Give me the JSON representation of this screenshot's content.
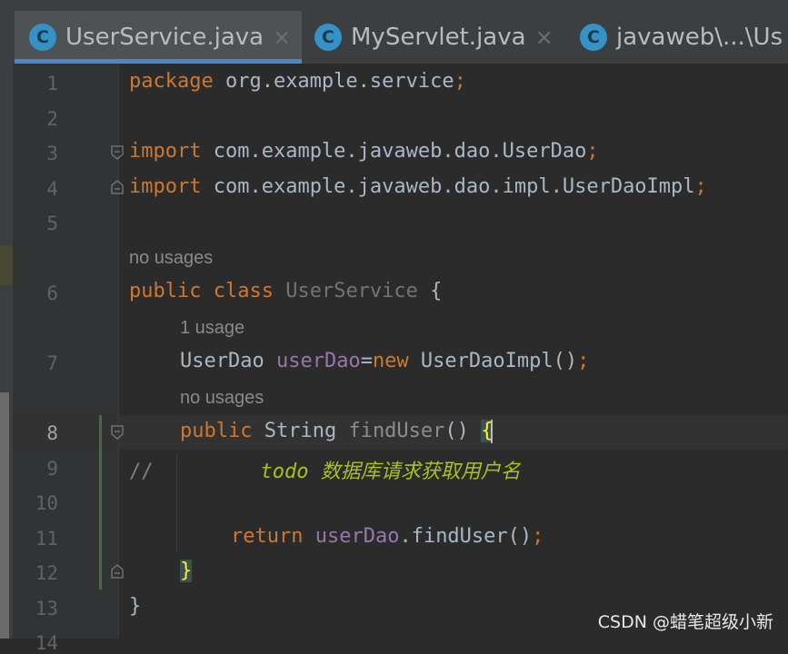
{
  "tabs": [
    {
      "icon": "C",
      "label": "UserService.java",
      "close": "×",
      "active": true
    },
    {
      "icon": "C",
      "label": "MyServlet.java",
      "close": "×",
      "active": false
    },
    {
      "icon": "C",
      "label": "javaweb\\...\\Us",
      "active": false
    }
  ],
  "line_numbers": [
    "1",
    "2",
    "3",
    "4",
    "5",
    "6",
    "7",
    "8",
    "9",
    "10",
    "11",
    "12",
    "13",
    "14"
  ],
  "code": {
    "l1_kw": "package",
    "l1_rest": " org.example.service",
    "l1_semi": ";",
    "l3_kw": "import",
    "l3_rest": " com.example.javaweb.dao.UserDao",
    "l3_semi": ";",
    "l4_kw": "import",
    "l4_rest": " com.example.javaweb.dao.impl.UserDaoImpl",
    "l4_semi": ";",
    "hint_class": "no usages",
    "l6_kw1": "public",
    "l6_kw2": " class",
    "l6_name": " UserService",
    "l6_brace": " {",
    "hint_field": "1 usage",
    "l7_type": "UserDao",
    "l7_field": " userDao",
    "l7_eq": "=",
    "l7_new": "new",
    "l7_ctor": " UserDaoImpl()",
    "l7_semi": ";",
    "hint_method": "no usages",
    "l8_kw": "public",
    "l8_type": " String",
    "l8_name": " findUser",
    "l8_parens": "() ",
    "l8_brace": "{",
    "l9_comment": "//",
    "l9_todo": "todo 数据库请求获取用户名",
    "l11_kw": "return",
    "l11_field": " userDao",
    "l11_call": ".findUser()",
    "l11_semi": ";",
    "l12_brace": "}",
    "l13_brace": "}"
  },
  "watermark": "CSDN @蜡笔超级小新",
  "colors": {
    "keyword": "#cc7832",
    "field": "#9876aa",
    "todo": "#a8c023",
    "background": "#2b2b2b",
    "tab_accent": "#4a88c7"
  }
}
